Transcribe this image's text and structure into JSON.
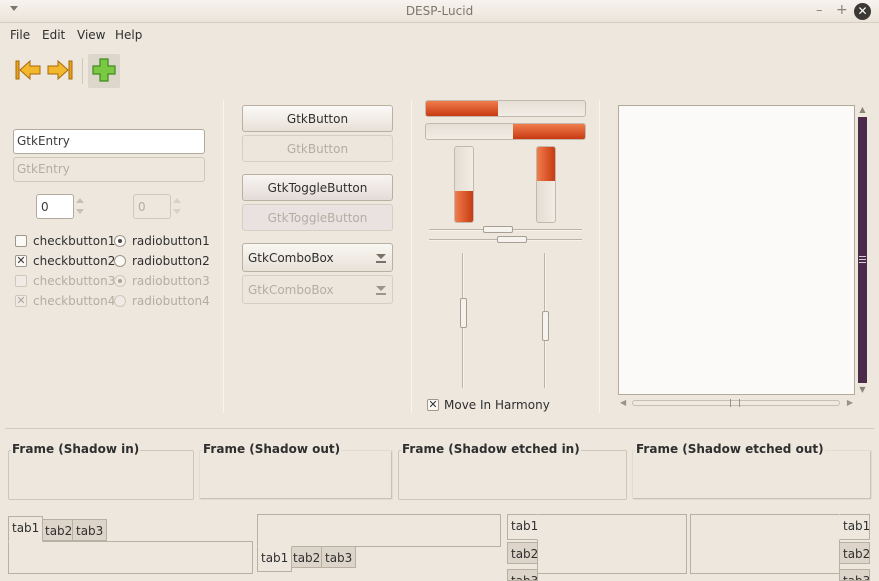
{
  "window": {
    "title": "DESP-Lucid"
  },
  "menubar": {
    "items": [
      "File",
      "Edit",
      "View",
      "Help"
    ]
  },
  "toolbar": {
    "back_icon": "go-back-icon",
    "forward_icon": "go-forward-icon",
    "add_icon": "add-icon",
    "icon_color": "#e8a21c",
    "add_color": "#6dbd3a"
  },
  "left_panel": {
    "entry_value": "GtkEntry",
    "entry_disabled_value": "GtkEntry",
    "spin_value": "0",
    "spin_disabled_value": "0",
    "checkbuttons": [
      {
        "label": "checkbutton1",
        "checked": false,
        "enabled": true
      },
      {
        "label": "checkbutton2",
        "checked": true,
        "enabled": true
      },
      {
        "label": "checkbutton3",
        "checked": false,
        "enabled": false
      },
      {
        "label": "checkbutton4",
        "checked": true,
        "enabled": false
      }
    ],
    "radiobuttons": [
      {
        "label": "radiobutton1",
        "selected": true,
        "enabled": true
      },
      {
        "label": "radiobutton2",
        "selected": false,
        "enabled": true
      },
      {
        "label": "radiobutton3",
        "selected": true,
        "enabled": false
      },
      {
        "label": "radiobutton4",
        "selected": false,
        "enabled": false
      }
    ]
  },
  "buttons_panel": {
    "button": "GtkButton",
    "button_disabled": "GtkButton",
    "toggle": "GtkToggleButton",
    "toggle_disabled": "GtkToggleButton",
    "combo": "GtkComboBox",
    "combo_disabled": "GtkComboBox"
  },
  "range_panel": {
    "progress1": 0.45,
    "progress2_start": 0.55,
    "vprogress1": 0.42,
    "vprogress2": 0.45,
    "accent": "#d9521f",
    "harmony_label": "Move In Harmony",
    "harmony_checked": true
  },
  "frames": [
    "Frame (Shadow in)",
    "Frame (Shadow out)",
    "Frame (Shadow etched in)",
    "Frame (Shadow etched out)"
  ],
  "notebooks": {
    "tabs": [
      "tab1",
      "tab2",
      "tab3"
    ]
  },
  "scrollbar_color": "#4c2a4a"
}
